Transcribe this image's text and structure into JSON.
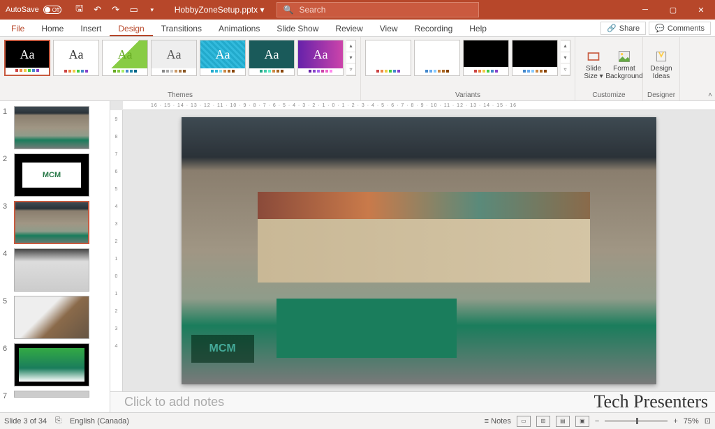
{
  "titlebar": {
    "autosave_label": "AutoSave",
    "autosave_state": "Off",
    "doc_title": "HobbyZoneSetup.pptx ▾",
    "search_placeholder": "Search"
  },
  "tabs": {
    "file": "File",
    "items": [
      "Home",
      "Insert",
      "Design",
      "Transitions",
      "Animations",
      "Slide Show",
      "Review",
      "View",
      "Recording",
      "Help"
    ],
    "active": "Design",
    "share": "Share",
    "comments": "Comments"
  },
  "ribbon": {
    "themes_label": "Themes",
    "variants_label": "Variants",
    "customize_label": "Customize",
    "designer_label": "Designer",
    "slide_size": "Slide Size ▾",
    "format_bg": "Format Background",
    "design_ideas": "Design Ideas"
  },
  "slides": {
    "count": 7,
    "active": 3
  },
  "notes": {
    "placeholder": "Click to add notes",
    "watermark": "Tech Presenters"
  },
  "statusbar": {
    "slide_info": "Slide 3 of 34",
    "language": "English (Canada)",
    "notes_btn": "Notes",
    "zoom": "75%"
  },
  "photo_logo": "MCM"
}
